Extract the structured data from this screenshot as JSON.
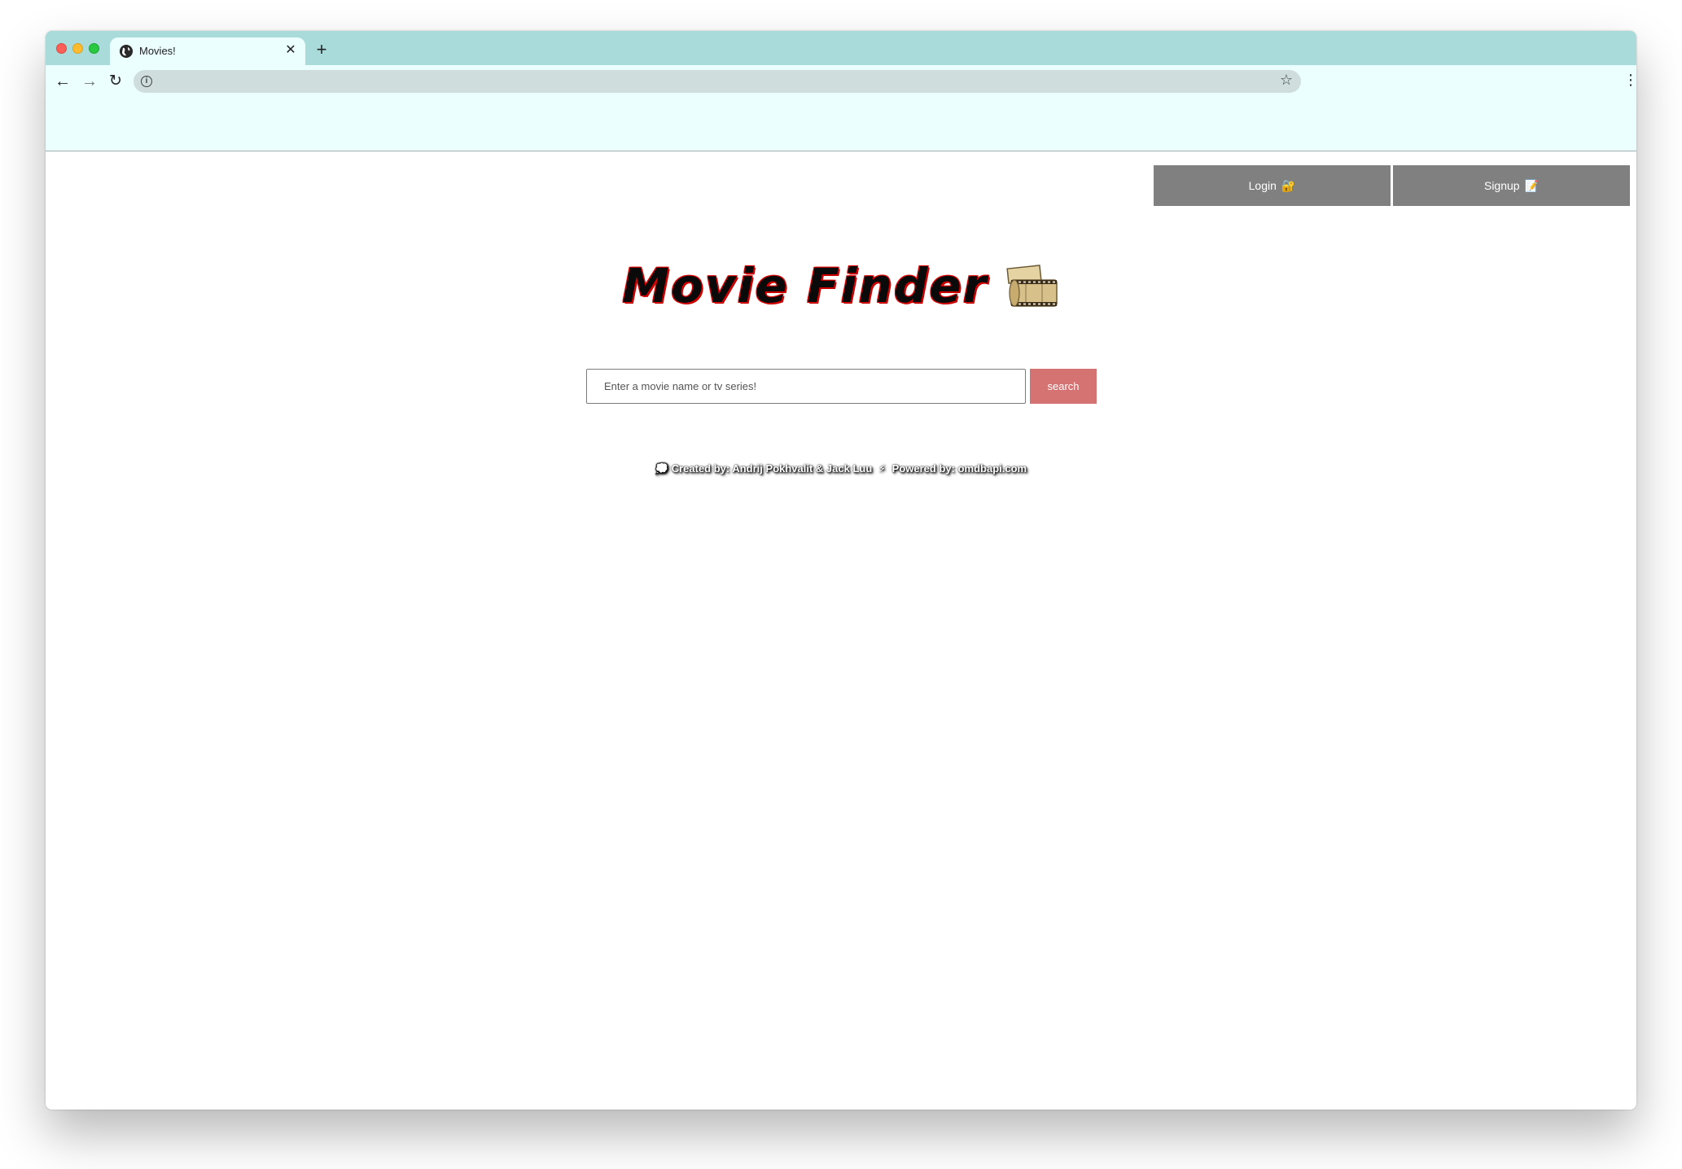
{
  "browser": {
    "tab": {
      "title": "Movies!",
      "close_symbol": "✕",
      "favicon": "globe-icon"
    },
    "new_tab_symbol": "+",
    "nav": {
      "back_symbol": "←",
      "forward_symbol": "→",
      "reload_symbol": "↻"
    },
    "omnibox": {
      "value": "",
      "info_symbol": "i",
      "star_symbol": "☆"
    },
    "menu_symbol": "⋮"
  },
  "header": {
    "login_label": "Login",
    "login_emoji": "🔐",
    "signup_label": "Signup",
    "signup_emoji": "📝"
  },
  "main": {
    "title": "Movie Finder",
    "title_icon": "film-reel-icon",
    "search": {
      "placeholder": "Enter a movie name or tv series!",
      "value": "",
      "button_label": "search"
    },
    "credits": {
      "created_prefix": "💭 Created by: Andrij Pokhvalit & Jack Luu",
      "separator": "⚡",
      "powered_by": "Powered by: omdbapi.com"
    }
  },
  "colors": {
    "tabstrip": "#a8dbd9",
    "toolbar": "#ebfffe",
    "auth_button": "#808080",
    "search_button": "#d57373",
    "title_outline": "#e00000"
  }
}
